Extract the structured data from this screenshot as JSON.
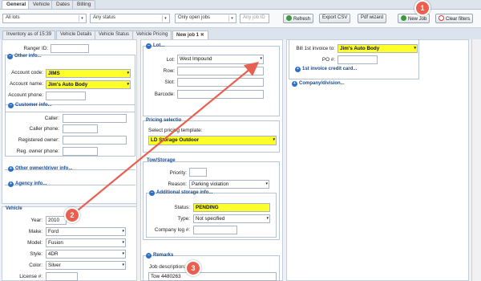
{
  "top_tabs": [
    "General",
    "Vehicle",
    "Dates",
    "Billing"
  ],
  "filters": {
    "lots": "All lots",
    "status": "Any status",
    "jobs": "Only open jobs",
    "job_id_placeholder": "Any job ID"
  },
  "toolbar": {
    "refresh": "Refresh",
    "export": "Export CSV",
    "pdf": "Pdf wizard",
    "new_job": "New Job",
    "clear": "Clear filters"
  },
  "sub_tabs": [
    "Inventory as of 15:39",
    "Vehicle Details",
    "Vehicle Status",
    "Vehicle Pricing",
    "New job 1"
  ],
  "left": {
    "ranger_label": "Ranger ID:",
    "other_info": "Other info...",
    "account_code_label": "Account code:",
    "account_code": "JIMS",
    "account_name_label": "Account name:",
    "account_name": "Jim's Auto Body",
    "account_phone_label": "Account phone:",
    "customer_info": "Customer info...",
    "caller_label": "Caller:",
    "caller_phone_label": "Caller phone:",
    "registered_owner_label": "Registered owner:",
    "reg_owner_phone_label": "Reg. owner phone:",
    "other_owner": "Other owner/driver info...",
    "agency_info": "Agency info...",
    "vehicle": "Vehicle",
    "year_label": "Year:",
    "year": "2010",
    "make_label": "Make:",
    "make": "Ford",
    "model_label": "Model:",
    "model": "Fusion",
    "style_label": "Style:",
    "style": "4DR",
    "color_label": "Color:",
    "color": "Silver",
    "license_label": "License #:"
  },
  "middle": {
    "lot_section": "Lot...",
    "lot_label": "Lot:",
    "lot": "West Impound",
    "row_label": "Row:",
    "slot_label": "Slot:",
    "barcode_label": "Barcode:",
    "pricing_section": "Pricing selectio",
    "pricing_template_label": "Select pricing template:",
    "pricing_template": "LD Storage Outdoor",
    "tow_storage": "Tow/Storage",
    "priority_label": "Priority:",
    "reason_label": "Reason:",
    "reason": "Parking violation",
    "additional_storage": "Additional storage info...",
    "status_label": "Status:",
    "status": "PENDING",
    "type_label": "Type:",
    "type": "Not specified",
    "company_log_label": "Company log #:",
    "remarks": "Remarks",
    "job_description_label": "Job description:",
    "job_description": "Tow 4480263"
  },
  "right": {
    "bill_label": "Bill 1st invoice to:",
    "bill_to": "Jim's Auto Body",
    "po_label": "PO #:",
    "credit_card": "1st invoice credit card...",
    "company_division": "Company/division..."
  },
  "callouts": [
    "1",
    "2",
    "3"
  ],
  "colors": {
    "highlight": "#ffff2a",
    "arrow": "#e8604f",
    "section": "#1a4b8c"
  }
}
